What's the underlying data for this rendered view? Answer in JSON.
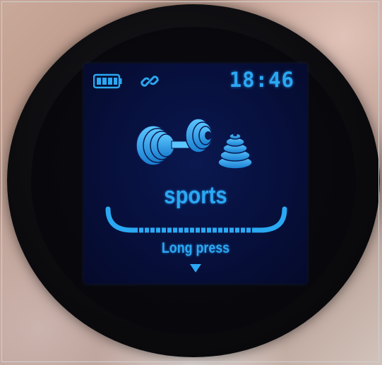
{
  "status_bar": {
    "battery_icon": "battery-full-icon",
    "link_icon": "link-chain-icon",
    "time": "18:46"
  },
  "main": {
    "mode_icon": "dumbbell-weights-icon",
    "mode_title": "sports",
    "hint": "Long press",
    "hint_icon": "triangle-down-icon"
  },
  "colors": {
    "accent": "#2aa8f2",
    "screen_bg": "#07103c",
    "bezel": "#0b0b0e"
  }
}
